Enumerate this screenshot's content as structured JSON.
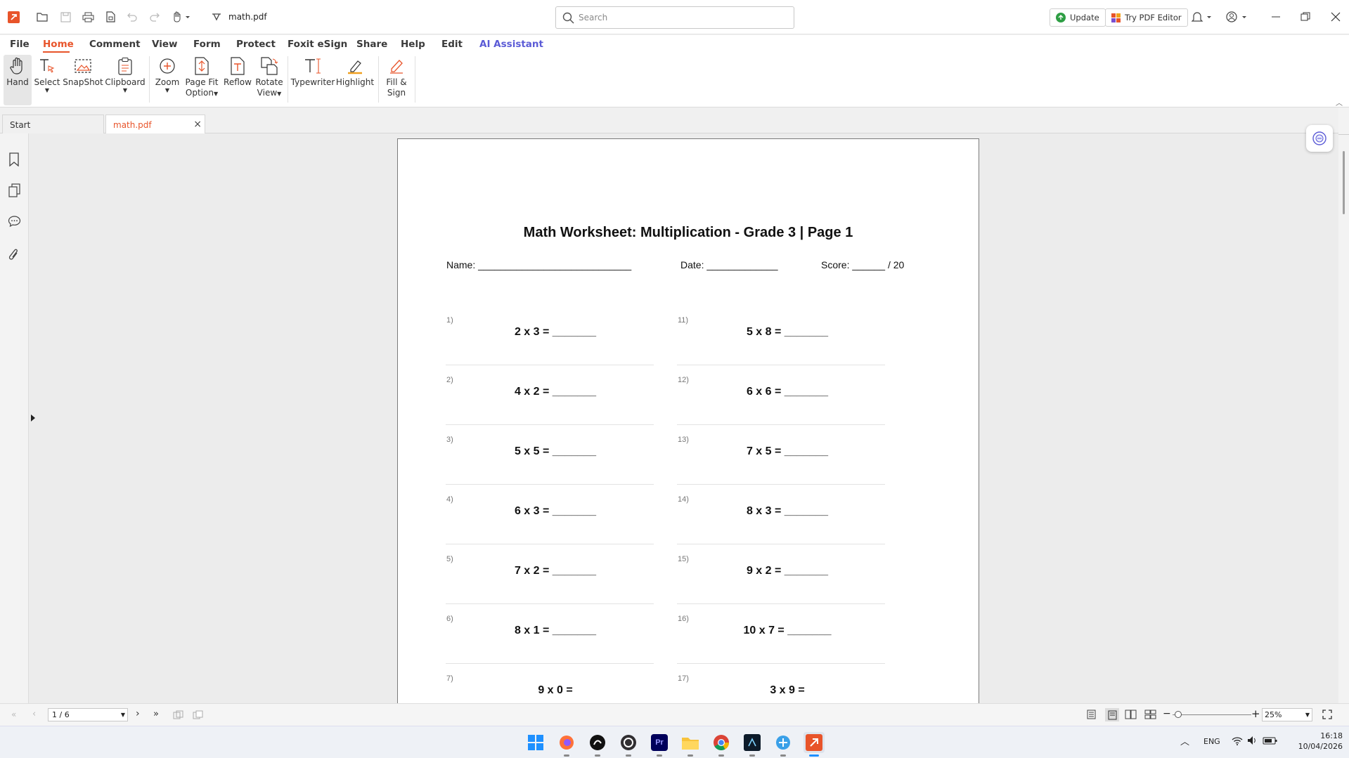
{
  "titlebar": {
    "filename": "math.pdf",
    "search_placeholder": "Search",
    "update_label": "Update",
    "try_editor_label": "Try PDF Editor"
  },
  "menu": [
    "File",
    "Home",
    "Comment",
    "View",
    "Form",
    "Protect",
    "Foxit eSign",
    "Share",
    "Help",
    "Edit",
    "AI Assistant"
  ],
  "menu_active": "Home",
  "ribbon": {
    "hand": "Hand",
    "select": "Select",
    "snapshot": "SnapShot",
    "clipboard": "Clipboard",
    "zoom": "Zoom",
    "pagefit_1": "Page Fit",
    "pagefit_2": "Option",
    "reflow": "Reflow",
    "rotate_1": "Rotate",
    "rotate_2": "View",
    "typewriter": "Typewriter",
    "highlight": "Highlight",
    "fillsign_1": "Fill &",
    "fillsign_2": "Sign"
  },
  "tabs": {
    "start": "Start",
    "doc": "math.pdf"
  },
  "worksheet": {
    "title": "Math Worksheet: Multiplication - Grade 3 | Page 1",
    "name_label": "Name: ____________________________",
    "date_label": "Date: _____________",
    "score_label": "Score: ______ / 20",
    "left_problems": [
      {
        "num": "1)",
        "text": "2 x 3 = _______"
      },
      {
        "num": "2)",
        "text": "4 x 2 = _______"
      },
      {
        "num": "3)",
        "text": "5 x 5 = _______"
      },
      {
        "num": "4)",
        "text": "6 x 3 = _______"
      },
      {
        "num": "5)",
        "text": "7 x 2 = _______"
      },
      {
        "num": "6)",
        "text": "8 x 1 = _______"
      },
      {
        "num": "7)",
        "text": "9 x 0 ="
      }
    ],
    "right_problems": [
      {
        "num": "11)",
        "text": "5 x 8 = _______"
      },
      {
        "num": "12)",
        "text": "6 x 6 = _______"
      },
      {
        "num": "13)",
        "text": "7 x 5 = _______"
      },
      {
        "num": "14)",
        "text": "8 x 3 = _______"
      },
      {
        "num": "15)",
        "text": "9 x 2 = _______"
      },
      {
        "num": "16)",
        "text": "10 x 7 = _______"
      },
      {
        "num": "17)",
        "text": "3 x 9 ="
      }
    ]
  },
  "status": {
    "page_value": "1 / 6",
    "zoom_value": "25%",
    "zoom_level": 0.07
  },
  "tray": {
    "lang": "ENG",
    "time": "16:18",
    "date": "10/04/2026"
  },
  "colors": {
    "accent": "#e8542a",
    "ai": "#5b5bd6",
    "update": "#2e9e44"
  }
}
